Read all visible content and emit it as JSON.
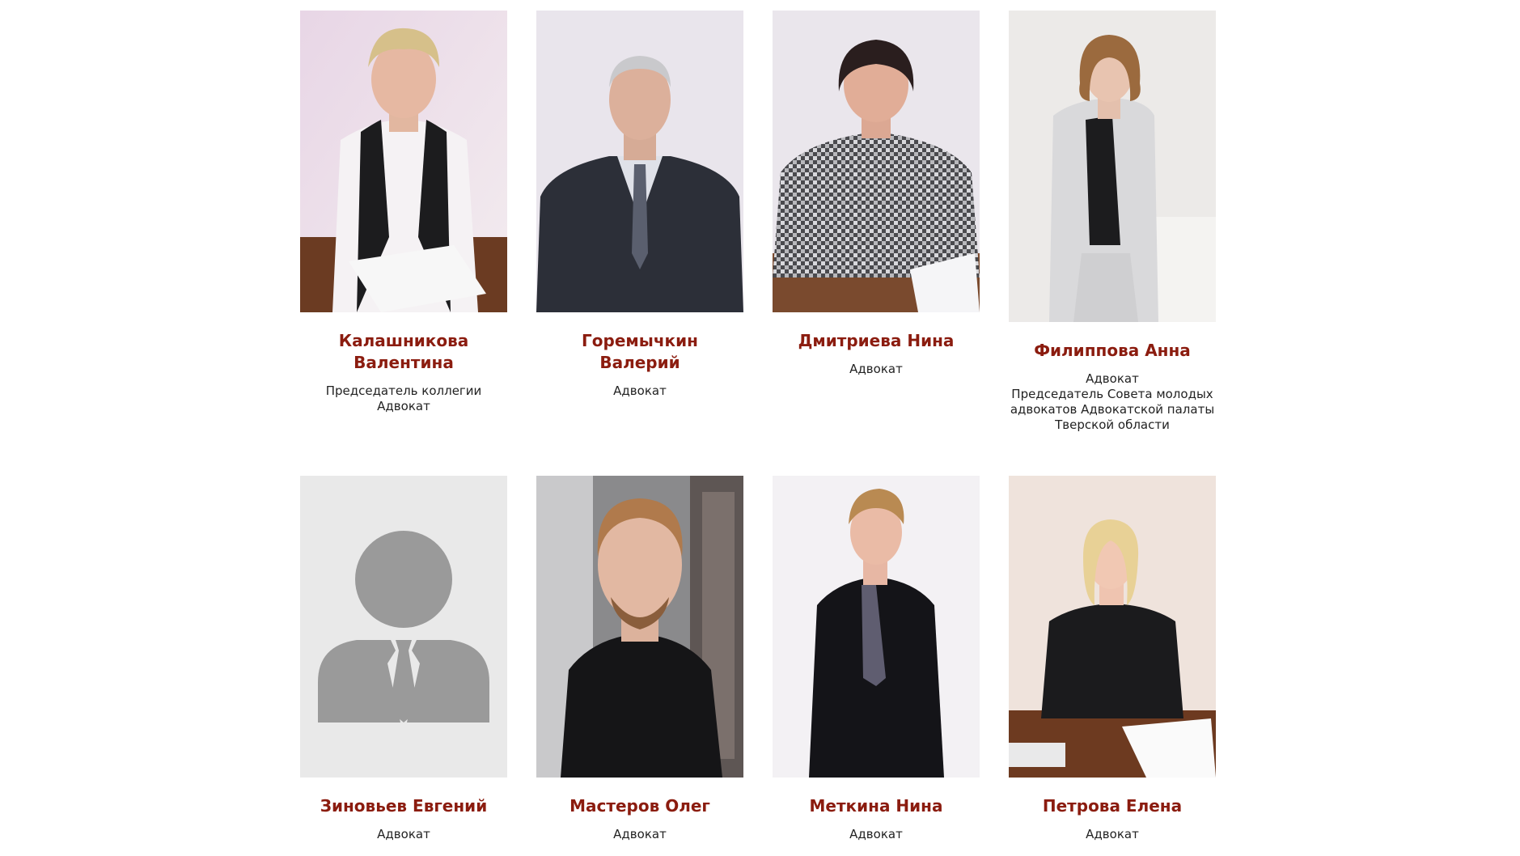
{
  "colors": {
    "name": "#8b1c0f",
    "role": "#222222",
    "placeholder_bg": "#e9e9e9",
    "placeholder_fg": "#9a9a9a"
  },
  "team": [
    {
      "name": "Калашникова Валентина",
      "roles": [
        "Председатель коллегии",
        "Адвокат"
      ]
    },
    {
      "name": "Горемычкин Валерий",
      "roles": [
        "Адвокат"
      ]
    },
    {
      "name": "Дмитриева Нина",
      "roles": [
        "Адвокат"
      ]
    },
    {
      "name": "Филиппова Анна",
      "roles": [
        "Адвокат",
        "Председатель Совета молодых",
        "адвокатов Адвокатской палаты",
        "Тверской области"
      ]
    },
    {
      "name": "Зиновьев Евгений",
      "roles": [
        "Адвокат"
      ],
      "photo_icon": "user-placeholder-icon"
    },
    {
      "name": "Мастеров Олег",
      "roles": [
        "Адвокат"
      ]
    },
    {
      "name": "Меткина Нина",
      "roles": [
        "Адвокат"
      ]
    },
    {
      "name": "Петрова Елена",
      "roles": [
        "Адвокат"
      ]
    }
  ]
}
